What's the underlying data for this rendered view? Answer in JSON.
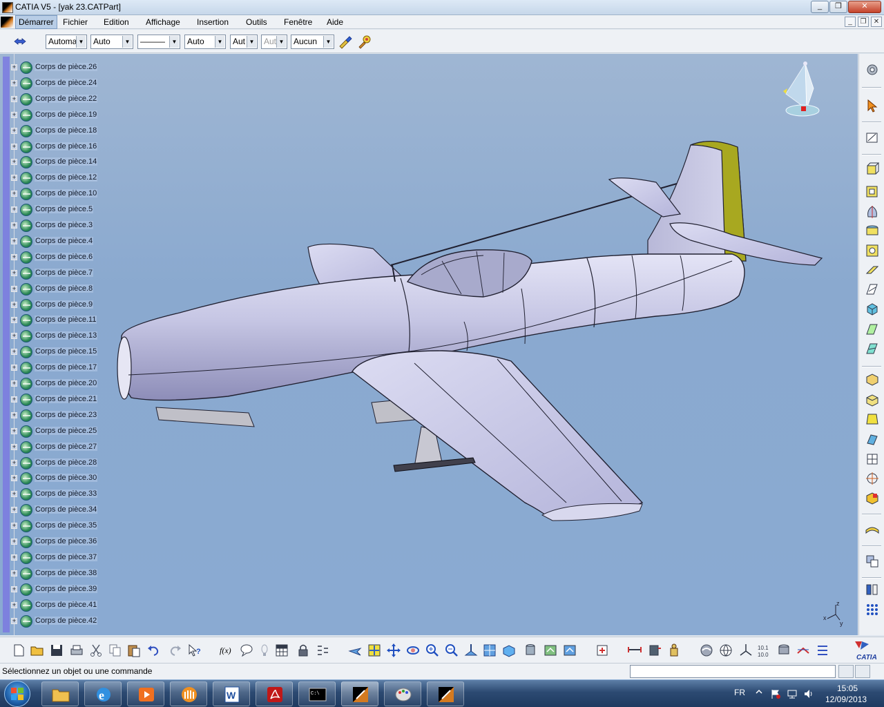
{
  "window": {
    "title": "CATIA V5 - [yak 23.CATPart]",
    "minimize": "_",
    "restore": "❐",
    "close": "✕"
  },
  "menubar": {
    "items": [
      "Démarrer",
      "Fichier",
      "Edition",
      "Affichage",
      "Insertion",
      "Outils",
      "Fenêtre",
      "Aide"
    ],
    "active_item": "Démarrer"
  },
  "mdi_controls": {
    "minimize": "_",
    "restore": "❐",
    "close": "✕"
  },
  "property_toolbar": {
    "color": "Automa",
    "transparency": "Auto",
    "linetype": "———",
    "thickness": "Auto",
    "point": "Aut",
    "layer_disabled": "Aut",
    "layer": "Aucun"
  },
  "tree": {
    "items": [
      "Corps de pièce.26",
      "Corps de pièce.24",
      "Corps de pièce.22",
      "Corps de pièce.19",
      "Corps de pièce.18",
      "Corps de pièce.16",
      "Corps de pièce.14",
      "Corps de pièce.12",
      "Corps de pièce.10",
      "Corps de pièce.5",
      "Corps de pièce.3",
      "Corps de pièce.4",
      "Corps de pièce.6",
      "Corps de pièce.7",
      "Corps de pièce.8",
      "Corps de pièce.9",
      "Corps de pièce.11",
      "Corps de pièce.13",
      "Corps de pièce.15",
      "Corps de pièce.17",
      "Corps de pièce.20",
      "Corps de pièce.21",
      "Corps de pièce.23",
      "Corps de pièce.25",
      "Corps de pièce.27",
      "Corps de pièce.28",
      "Corps de pièce.30",
      "Corps de pièce.33",
      "Corps de pièce.34",
      "Corps de pièce.35",
      "Corps de pièce.36",
      "Corps de pièce.37",
      "Corps de pièce.38",
      "Corps de pièce.39",
      "Corps de pièce.41",
      "Corps de pièce.42"
    ]
  },
  "axis": {
    "z": "z",
    "x": "x",
    "y": "y"
  },
  "toolbar_formula_label": "f(x)",
  "statusbar": {
    "message": "Sélectionnez un objet ou une commande",
    "command_value": ""
  },
  "catia_logo": "CATIA",
  "taskbar": {
    "language": "FR",
    "time": "15:05",
    "date": "12/09/2013"
  },
  "colors": {
    "fuselage": "#c8c8e8",
    "rudder": "#a8a820",
    "viewport_bg": "#8aa9cf"
  }
}
